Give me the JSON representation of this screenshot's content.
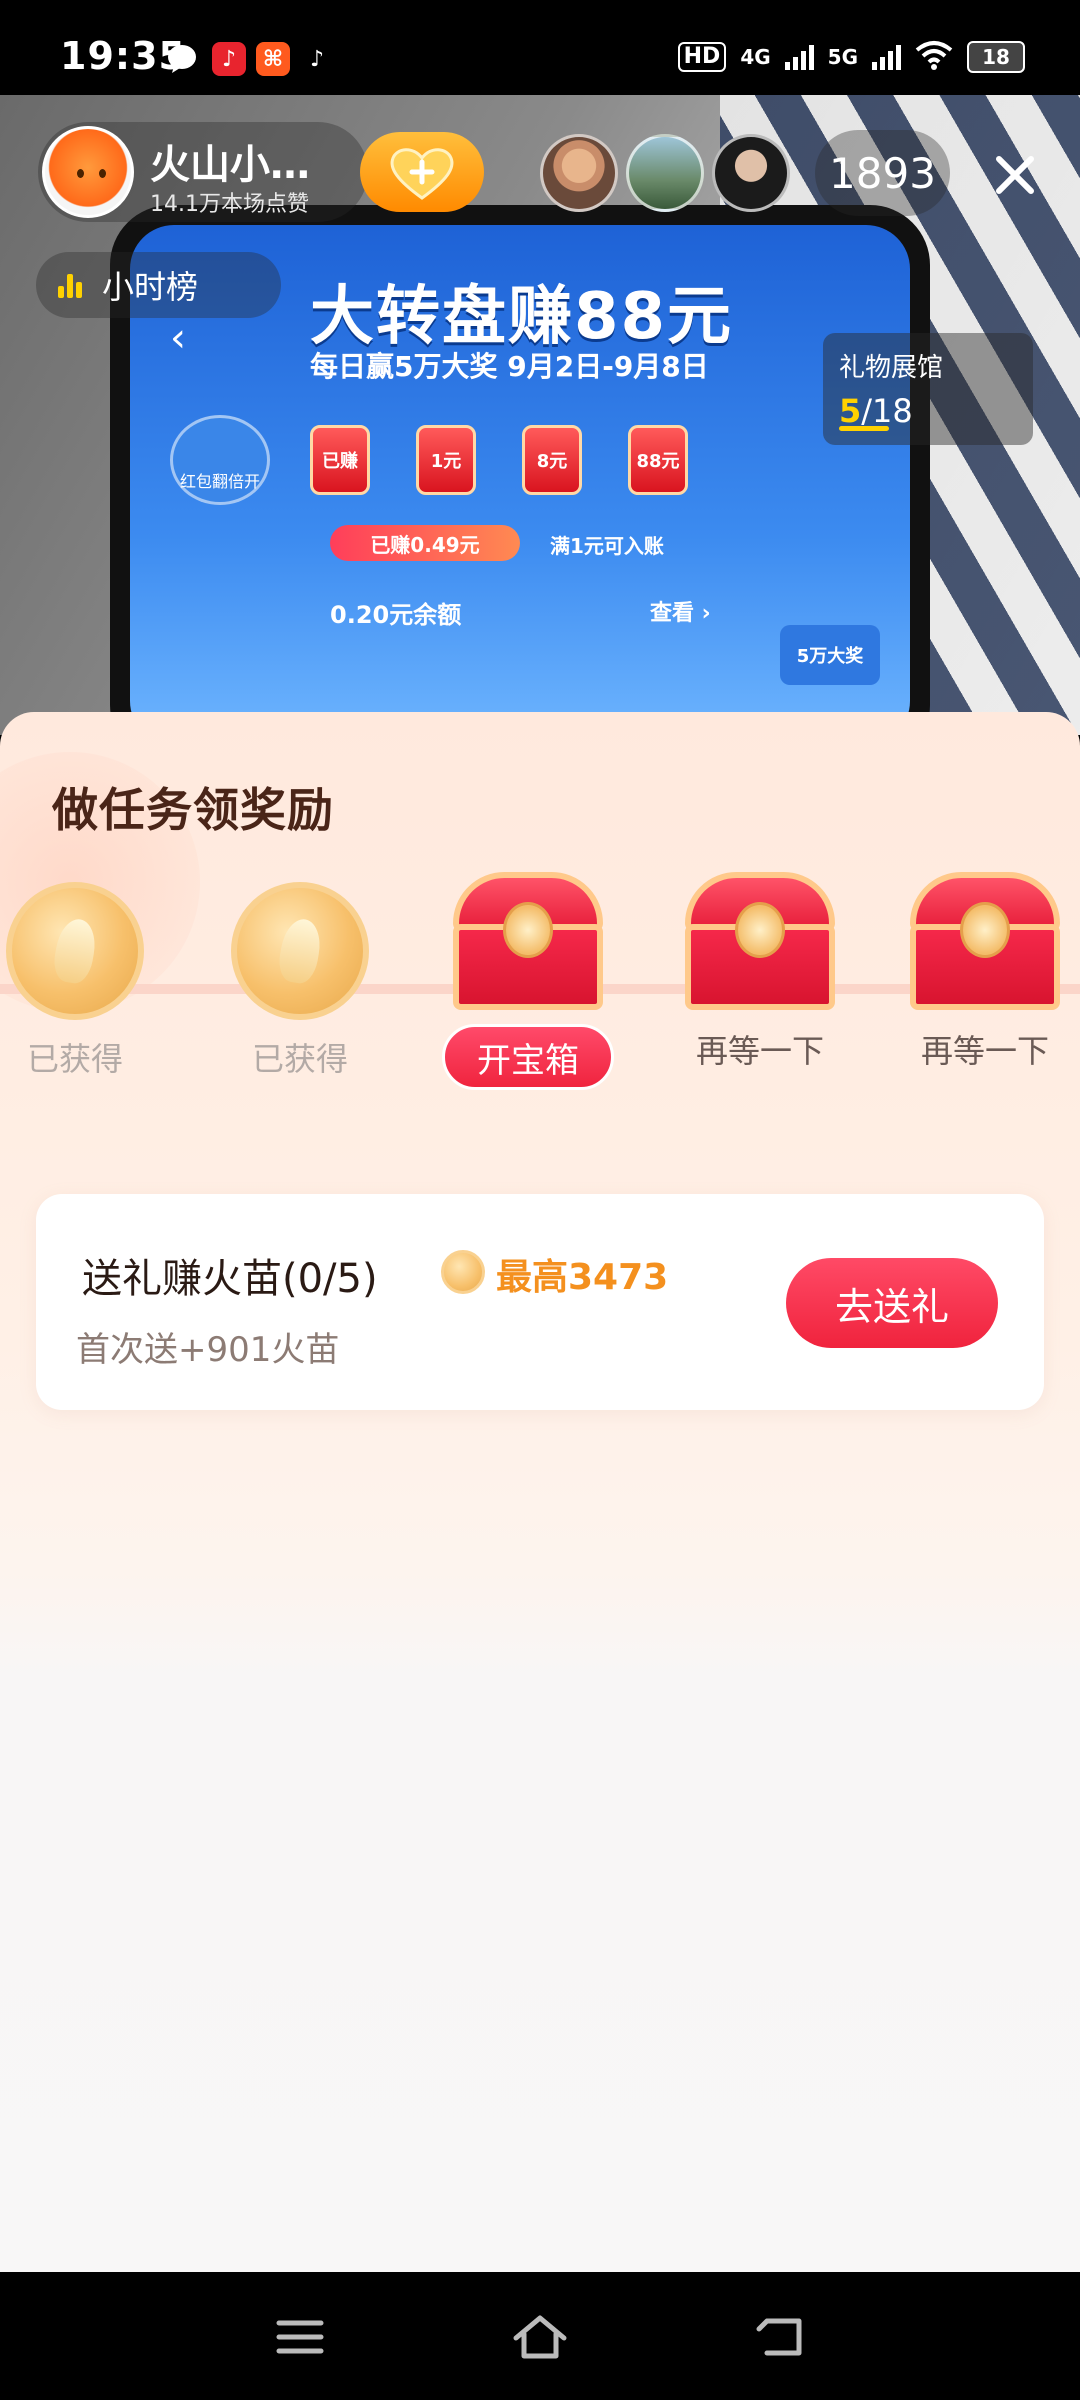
{
  "status_bar": {
    "time": "19:35",
    "notification_icons": [
      "message-icon",
      "douyin-icon",
      "app-icon",
      "tiktok-icon"
    ],
    "hd_label": "HD",
    "net1": "4G",
    "net2": "5G",
    "battery": "18"
  },
  "live_header": {
    "host_name": "火山小…",
    "host_likes": "14.1万本场点赞",
    "viewer_count": "1893",
    "hour_rank_label": "小时榜",
    "gift_hall": {
      "title": "礼物展馆",
      "current": "5",
      "total": "/18",
      "progress": 0.28
    }
  },
  "stream_content": {
    "title": "大转盘赚88元",
    "subtitle": "每日赢5万大奖 9月2日-9月8日",
    "envelopes": [
      "已赚",
      "1元",
      "8元",
      "88元"
    ],
    "earned_pill": "已赚0.49元",
    "threshold_text": "满1元可入账",
    "balance_text": "0.20元余额",
    "view_text": "查看 ›",
    "left_badge": "红包翻倍开",
    "prize_badge": "5万大奖"
  },
  "sheet": {
    "title": "做任务领奖励",
    "rewards": [
      {
        "type": "coin",
        "label": "已获得"
      },
      {
        "type": "coin",
        "label": "已获得"
      },
      {
        "type": "chest",
        "label": "开宝箱"
      },
      {
        "type": "chest",
        "label": "再等一下"
      },
      {
        "type": "chest",
        "label": "再等一下"
      }
    ],
    "task": {
      "name": "送礼赚火苗(0/5)",
      "max_label": "最高3473",
      "desc": "首次送+901火苗",
      "button": "去送礼"
    }
  },
  "colors": {
    "accent_red": "#f0243e",
    "accent_orange": "#f4901e",
    "gold": "#ffd100"
  }
}
